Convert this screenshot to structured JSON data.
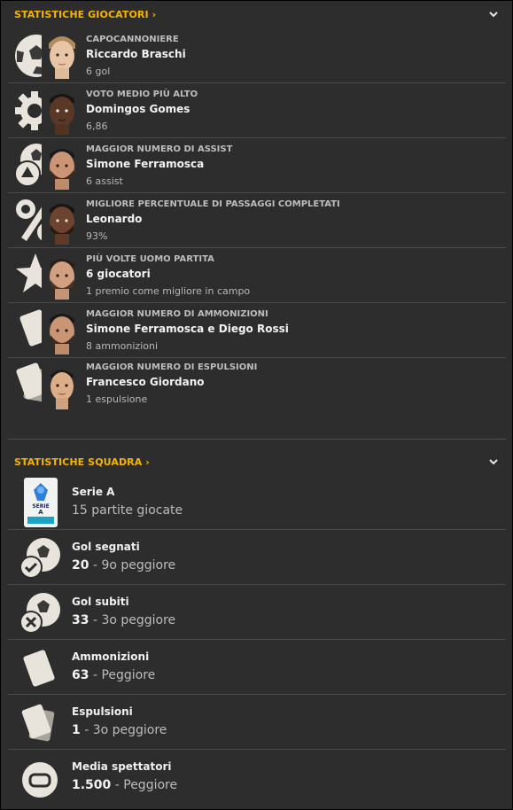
{
  "players_section": {
    "title": "STATISTICHE GIOCATORI"
  },
  "player_stats": [
    {
      "icon": "football-icon",
      "label": "CAPOCANNONIERE",
      "name": "Riccardo Braschi",
      "value": "6 gol"
    },
    {
      "icon": "rating-gear-icon",
      "label": "VOTO MEDIO PIÙ ALTO",
      "name": "Domingos Gomes",
      "value": "6,86"
    },
    {
      "icon": "assist-icon",
      "label": "MAGGIOR NUMERO DI ASSIST",
      "name": "Simone Ferramosca",
      "value": "6 assist"
    },
    {
      "icon": "percent-icon",
      "label": "MIGLIORE PERCENTUALE DI PASSAGGI COMPLETATI",
      "name": "Leonardo",
      "value": "93%"
    },
    {
      "icon": "star-icon",
      "label": "PIÙ VOLTE UOMO PARTITA",
      "name": "6 giocatori",
      "value": "1 premio come migliore in campo"
    },
    {
      "icon": "yellow-card-icon",
      "label": "MAGGIOR NUMERO DI AMMONIZIONI",
      "name": "Simone Ferramosca e Diego Rossi",
      "value": "8 ammonizioni"
    },
    {
      "icon": "red-card-icon",
      "label": "MAGGIOR NUMERO DI ESPULSIONI",
      "name": "Francesco Giordano",
      "value": "1 espulsione"
    }
  ],
  "team_section": {
    "title": "STATISTICHE SQUADRA"
  },
  "team_stats": [
    {
      "icon": "serie-a-logo-icon",
      "label": "Serie A",
      "value": "",
      "detail": "15 partite giocate"
    },
    {
      "icon": "goals-scored-icon",
      "label": "Gol segnati",
      "value": "20",
      "detail": "- 9o peggiore"
    },
    {
      "icon": "goals-conceded-icon",
      "label": "Gol subiti",
      "value": "33",
      "detail": "- 3o peggiore"
    },
    {
      "icon": "yellow-card-icon",
      "label": "Ammonizioni",
      "value": "63",
      "detail": "- Peggiore"
    },
    {
      "icon": "red-card-icon",
      "label": "Espulsioni",
      "value": "1",
      "detail": "- 3o peggiore"
    },
    {
      "icon": "stadium-icon",
      "label": "Media spettatori",
      "value": "1.500",
      "detail": "- Peggiore"
    }
  ],
  "serie_a_logo": {
    "line1": "SERIE",
    "line2": "A"
  }
}
